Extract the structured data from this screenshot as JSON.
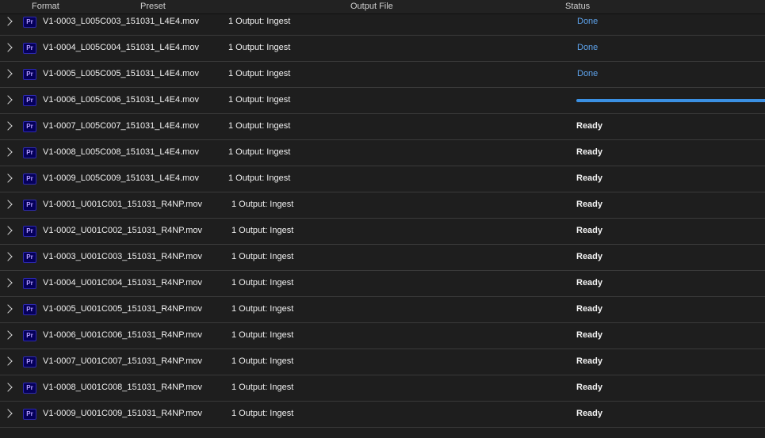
{
  "header": {
    "format": "Format",
    "preset": "Preset",
    "output_file": "Output File",
    "status": "Status"
  },
  "icons": {
    "expand": "chevron-right-icon",
    "app": "premiere-pro-icon",
    "app_glyph": "Pr"
  },
  "colors": {
    "done": "#5ea3ec",
    "progress": "#3b90e3",
    "app_icon_bg": "#05005a",
    "app_icon_text": "#b39cff"
  },
  "rows": [
    {
      "file": "V1-0003_L005C003_151031_L4E4.mov",
      "preset": "1 Output: Ingest",
      "status": "Done"
    },
    {
      "file": "V1-0004_L005C004_151031_L4E4.mov",
      "preset": "1 Output: Ingest",
      "status": "Done"
    },
    {
      "file": "V1-0005_L005C005_151031_L4E4.mov",
      "preset": "1 Output: Ingest",
      "status": "Done"
    },
    {
      "file": "V1-0006_L005C006_151031_L4E4.mov",
      "preset": "1 Output: Ingest",
      "status": ""
    },
    {
      "file": "V1-0007_L005C007_151031_L4E4.mov",
      "preset": "1 Output: Ingest",
      "status": "Ready"
    },
    {
      "file": "V1-0008_L005C008_151031_L4E4.mov",
      "preset": "1 Output: Ingest",
      "status": "Ready"
    },
    {
      "file": "V1-0009_L005C009_151031_L4E4.mov",
      "preset": "1 Output: Ingest",
      "status": "Ready"
    },
    {
      "file": "V1-0001_U001C001_151031_R4NP.mov",
      "preset": "1 Output: Ingest",
      "status": "Ready"
    },
    {
      "file": "V1-0002_U001C002_151031_R4NP.mov",
      "preset": "1 Output: Ingest",
      "status": "Ready"
    },
    {
      "file": "V1-0003_U001C003_151031_R4NP.mov",
      "preset": "1 Output: Ingest",
      "status": "Ready"
    },
    {
      "file": "V1-0004_U001C004_151031_R4NP.mov",
      "preset": "1 Output: Ingest",
      "status": "Ready"
    },
    {
      "file": "V1-0005_U001C005_151031_R4NP.mov",
      "preset": "1 Output: Ingest",
      "status": "Ready"
    },
    {
      "file": "V1-0006_U001C006_151031_R4NP.mov",
      "preset": "1 Output: Ingest",
      "status": "Ready"
    },
    {
      "file": "V1-0007_U001C007_151031_R4NP.mov",
      "preset": "1 Output: Ingest",
      "status": "Ready"
    },
    {
      "file": "V1-0008_U001C008_151031_R4NP.mov",
      "preset": "1 Output: Ingest",
      "status": "Ready"
    },
    {
      "file": "V1-0009_U001C009_151031_R4NP.mov",
      "preset": "1 Output: Ingest",
      "status": "Ready"
    }
  ]
}
